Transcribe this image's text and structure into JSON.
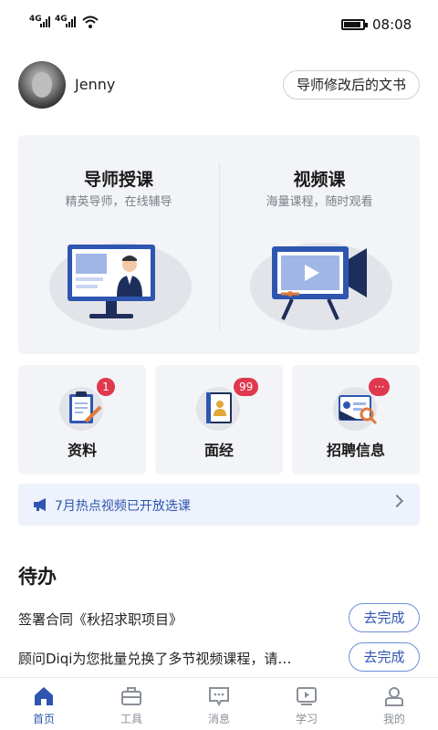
{
  "status_bar": {
    "signal_1": "4G",
    "signal_2": "4G",
    "time": "08:08"
  },
  "profile": {
    "username": "Jenny",
    "doc_button_label": "导师修改后的文书"
  },
  "courses": [
    {
      "title": "导师授课",
      "subtitle": "精英导师，在线辅导"
    },
    {
      "title": "视频课",
      "subtitle": "海量课程，随时观看"
    }
  ],
  "tiles": [
    {
      "label": "资料",
      "badge": "1"
    },
    {
      "label": "面经",
      "badge": "99"
    },
    {
      "label": "招聘信息",
      "badge": "···"
    }
  ],
  "notice": {
    "text": "7月热点视频已开放选课"
  },
  "todo": {
    "heading": "待办",
    "items": [
      {
        "text": "签署合同《秋招求职项目》",
        "button": "去完成"
      },
      {
        "text": "顾问Diqi为您批量兑换了多节视频课程，请…",
        "button": "去完成"
      }
    ]
  },
  "tabbar": {
    "tabs": [
      {
        "label": "首页",
        "icon": "home-icon",
        "active": true
      },
      {
        "label": "工具",
        "icon": "toolbox-icon",
        "active": false
      },
      {
        "label": "消息",
        "icon": "message-icon",
        "active": false
      },
      {
        "label": "学习",
        "icon": "study-icon",
        "active": false
      },
      {
        "label": "我的",
        "icon": "profile-icon",
        "active": false
      }
    ]
  },
  "colors": {
    "accent": "#2e55b0",
    "badge": "#e0384e",
    "card_bg": "#f3f4f7",
    "notice_bg": "#edf2fc"
  }
}
